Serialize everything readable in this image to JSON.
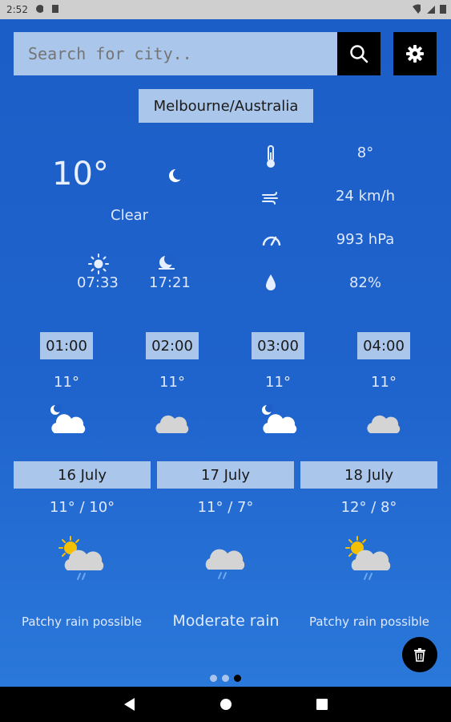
{
  "statusbar": {
    "time": "2:52"
  },
  "search": {
    "placeholder": "Search for city.."
  },
  "location": "Melbourne/Australia",
  "current": {
    "temp": "10°",
    "condition": "Clear",
    "sunrise": "07:33",
    "sunset": "17:21",
    "feels_like": "8°",
    "wind": "24 km/h",
    "pressure": "993 hPa",
    "humidity": "82%"
  },
  "hourly": [
    {
      "time": "01:00",
      "temp": "11°",
      "icon": "moon-cloud-icon"
    },
    {
      "time": "02:00",
      "temp": "11°",
      "icon": "cloud-icon"
    },
    {
      "time": "03:00",
      "temp": "11°",
      "icon": "moon-cloud-icon"
    },
    {
      "time": "04:00",
      "temp": "11°",
      "icon": "cloud-icon"
    }
  ],
  "daily": [
    {
      "date": "16 July",
      "temps": "11° / 10°",
      "desc": "Patchy rain possible",
      "icon": "sun-cloud-rain-icon"
    },
    {
      "date": "17 July",
      "temps": "11° / 7°",
      "desc": "Moderate rain",
      "icon": "cloud-rain-icon"
    },
    {
      "date": "18 July",
      "temps": "12° / 8°",
      "desc": "Patchy rain possible",
      "icon": "sun-cloud-rain-icon"
    }
  ],
  "pager": {
    "count": 3,
    "active": 3
  },
  "colors": {
    "background": "#1e5fc8",
    "panel": "#aac6ea",
    "button": "#000000"
  }
}
